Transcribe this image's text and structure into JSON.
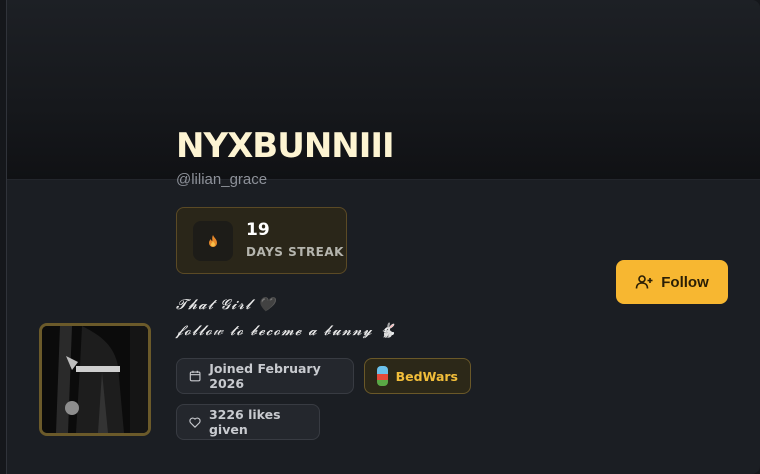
{
  "profile": {
    "display_name": "NYXBUNNIII",
    "handle": "@lilian_grace",
    "bio_line1": "𝓣𝓱𝓪𝓽 𝓖𝓲𝓻𝓵 🖤",
    "bio_line2": "𝓯𝓸𝓵𝓵𝓸𝓌 𝓽𝓸 𝓫𝓮𝓬𝓸𝓶𝓮 𝓪 𝓫𝓾𝓷𝓷𝔂 🐇"
  },
  "streak": {
    "count": "19",
    "label": "DAYS STREAK",
    "icon": "flame-icon"
  },
  "follow_button": {
    "label": "Follow",
    "icon": "add-user-icon"
  },
  "badges": {
    "joined": "Joined February 2026",
    "game": "BedWars",
    "likes": "3226 likes given"
  },
  "colors": {
    "accent": "#f7b731",
    "name_text": "#fdf4d2",
    "card_bg": "#1b1e23"
  }
}
